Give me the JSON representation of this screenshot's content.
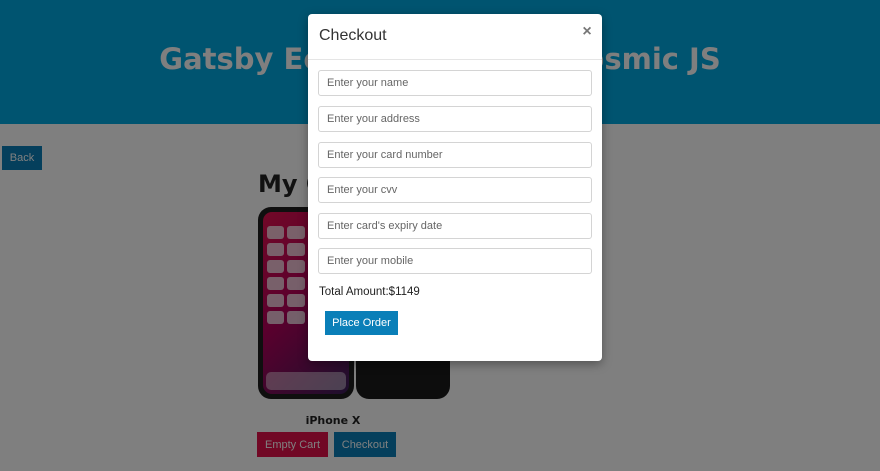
{
  "header": {
    "title": "Gatsby Ecommerce with Cosmic JS"
  },
  "nav": {
    "back_label": "Back"
  },
  "cart": {
    "title": "My Cart",
    "product_name": "iPhone X",
    "empty_cart_label": "Empty Cart",
    "checkout_label": "Checkout"
  },
  "modal": {
    "title": "Checkout",
    "close_symbol": "×",
    "fields": [
      {
        "placeholder": "Enter your name",
        "value": ""
      },
      {
        "placeholder": "Enter your address",
        "value": ""
      },
      {
        "placeholder": "Enter your card number",
        "value": ""
      },
      {
        "placeholder": "Enter your cvv",
        "value": ""
      },
      {
        "placeholder": "Enter card's expiry date",
        "value": ""
      },
      {
        "placeholder": "Enter your mobile",
        "value": ""
      }
    ],
    "total_amount": "Total Amount:$1149",
    "place_order_label": "Place Order"
  },
  "colors": {
    "header_bg": "#00a9e0",
    "primary_button": "#0a7fb8",
    "danger_button": "#e3104a",
    "overlay": "rgba(0,0,0,0.5)"
  },
  "icons": {
    "close": "close-icon"
  }
}
